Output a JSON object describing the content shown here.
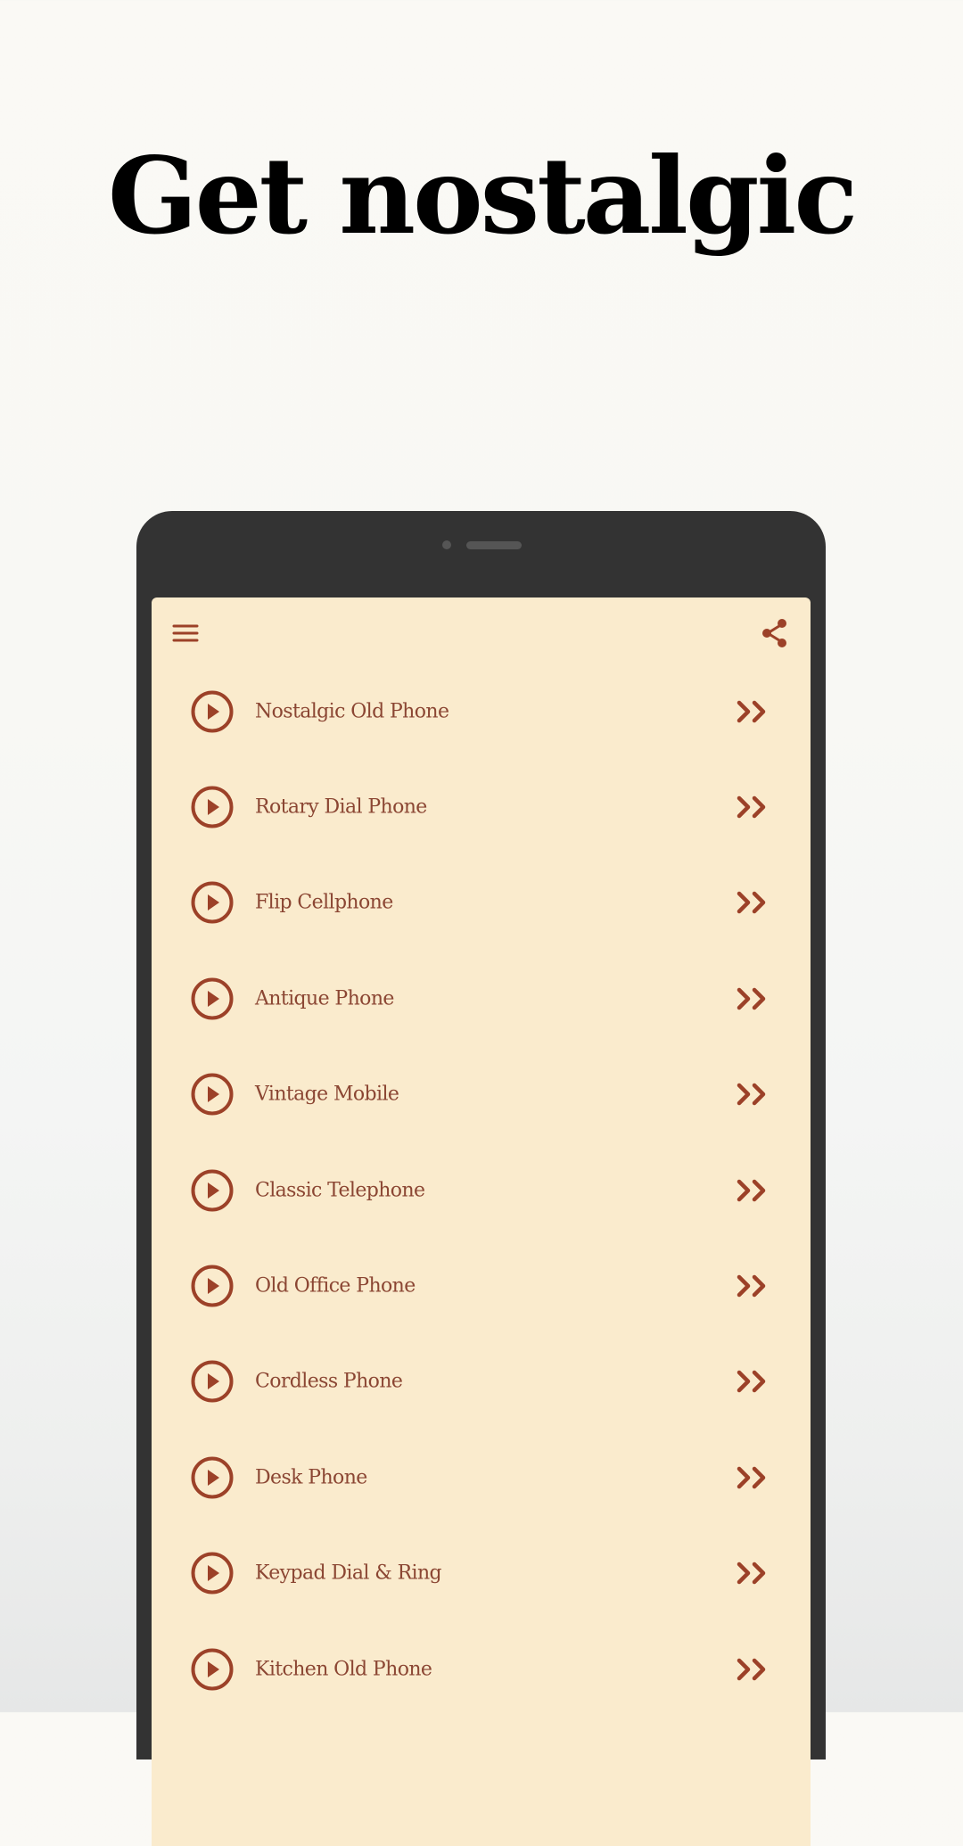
{
  "headline": "Get nostalgic",
  "colors": {
    "accent": "#9c4128",
    "label_text": "#8b4633",
    "screen_bg": "#faebcd",
    "device_frame": "#333333",
    "headline": "#000000"
  },
  "app_bar": {
    "menu_icon": "hamburger-menu-icon",
    "share_icon": "share-icon"
  },
  "list": {
    "row_leading_icon": "play-circle-icon",
    "row_trailing_icon": "double-chevron-right-icon",
    "items": [
      {
        "label": "Nostalgic Old Phone"
      },
      {
        "label": "Rotary Dial Phone"
      },
      {
        "label": "Flip Cellphone"
      },
      {
        "label": "Antique Phone"
      },
      {
        "label": "Vintage Mobile"
      },
      {
        "label": "Classic Telephone"
      },
      {
        "label": "Old Office Phone"
      },
      {
        "label": "Cordless Phone"
      },
      {
        "label": "Desk Phone"
      },
      {
        "label": "Keypad Dial & Ring"
      },
      {
        "label": "Kitchen Old Phone"
      }
    ]
  }
}
